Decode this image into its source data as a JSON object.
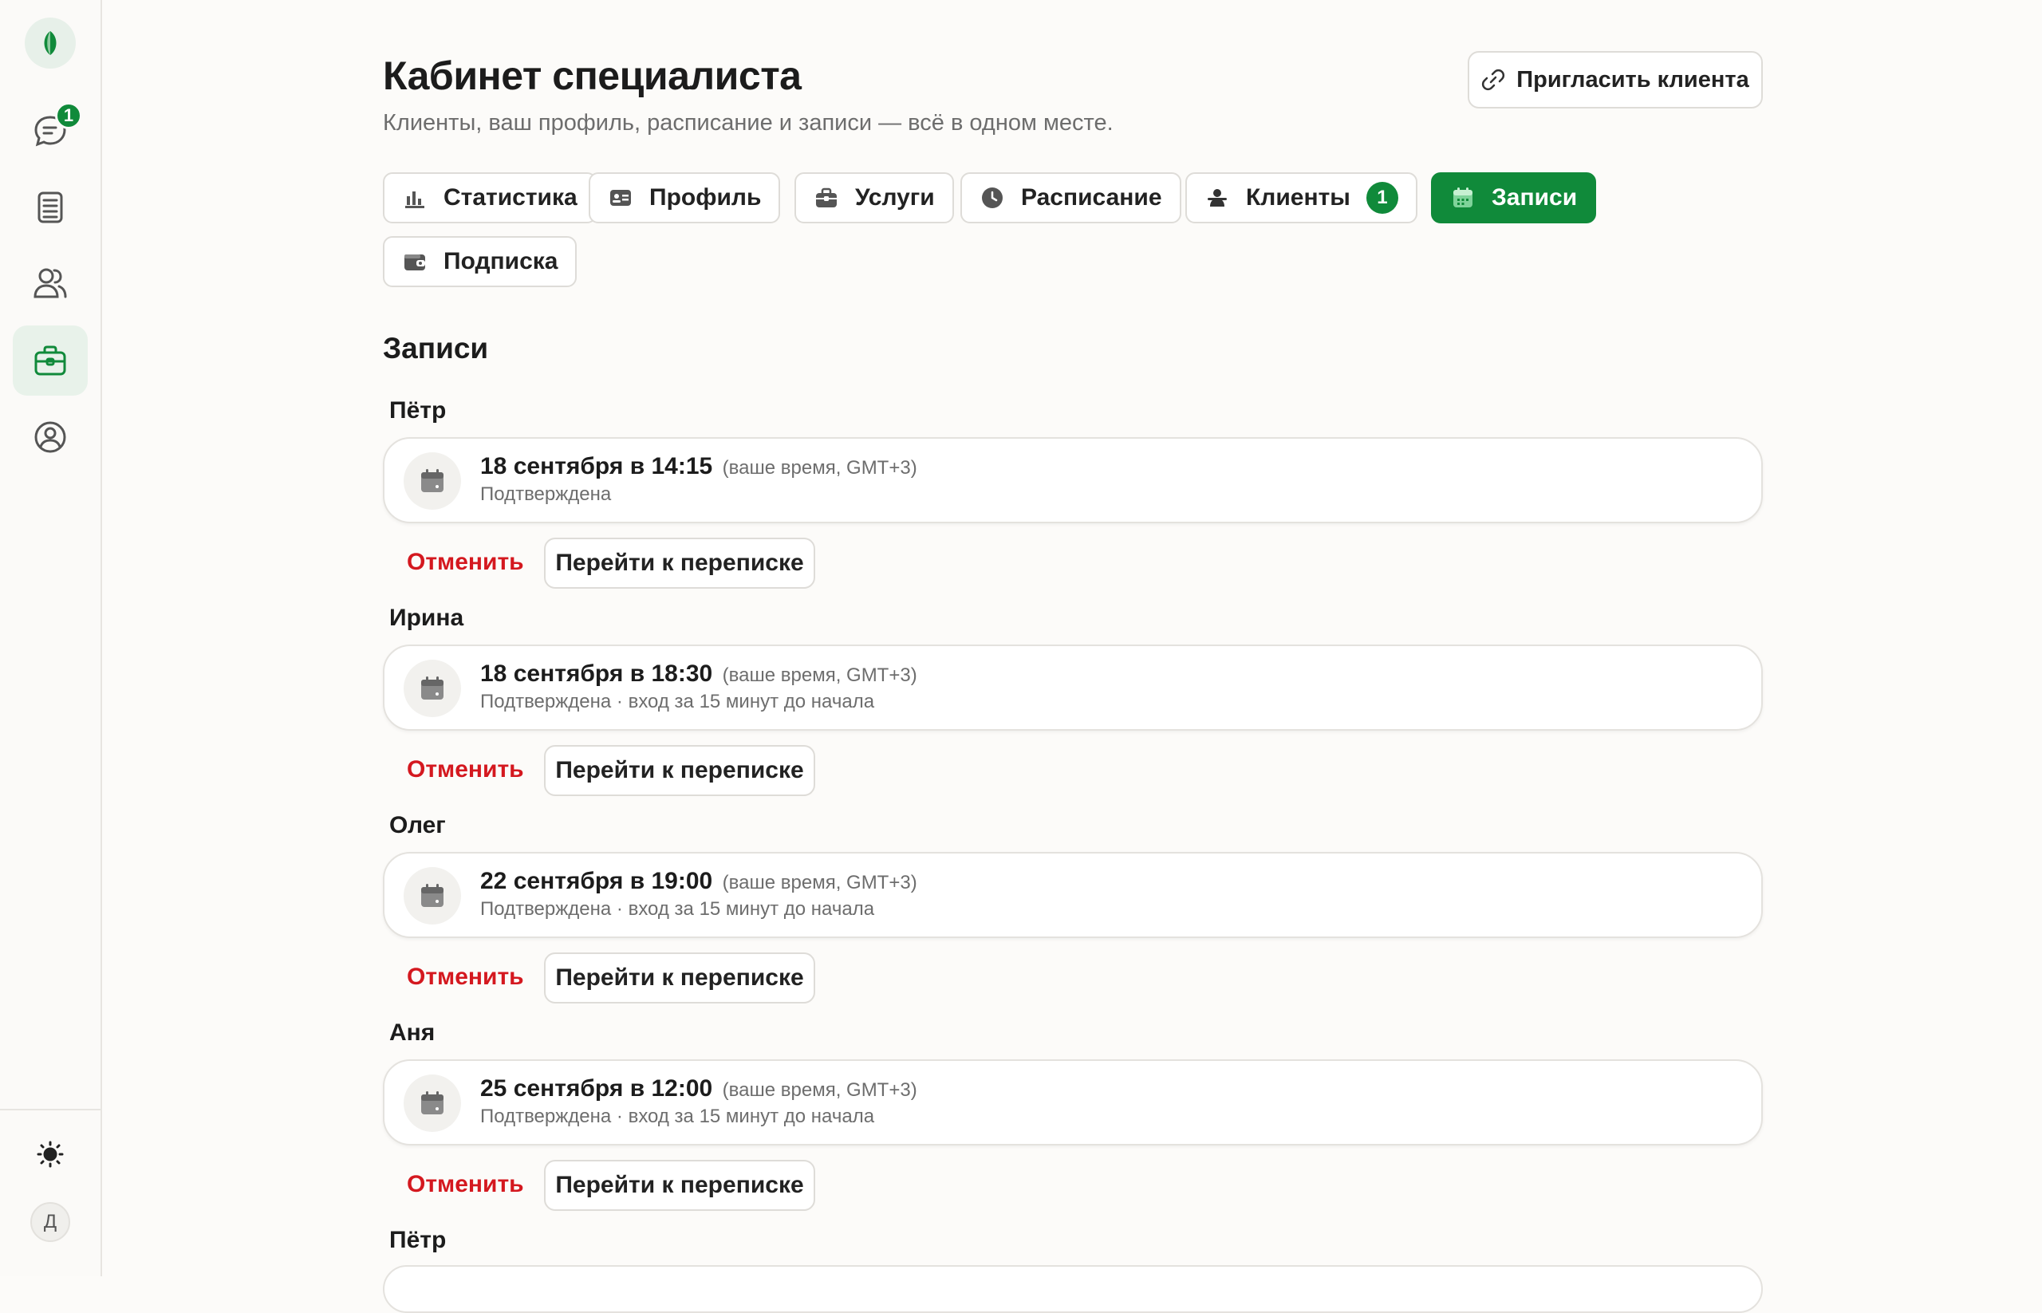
{
  "sidebar": {
    "notification_count": "1",
    "user_initial": "Д"
  },
  "header": {
    "title": "Кабинет специалиста",
    "subtitle": "Клиенты, ваш профиль, расписание и записи — всё в одном месте.",
    "invite_label": "Пригласить клиента"
  },
  "tabs": [
    {
      "label": "Статистика",
      "icon": "bar-chart-icon"
    },
    {
      "label": "Профиль",
      "icon": "id-card-icon"
    },
    {
      "label": "Услуги",
      "icon": "briefcase-icon"
    },
    {
      "label": "Расписание",
      "icon": "clock-icon"
    },
    {
      "label": "Клиенты",
      "icon": "people-icon",
      "count": "1"
    },
    {
      "label": "Записи",
      "icon": "calendar-icon",
      "active": true
    },
    {
      "label": "Подписка",
      "icon": "wallet-icon"
    }
  ],
  "section_title": "Записи",
  "bookings": [
    {
      "client": "Пётр",
      "date": "18 сентября в 14:15",
      "tz": "(ваше время, GMT+3)",
      "status": "Подтверждена"
    },
    {
      "client": "Ирина",
      "date": "18 сентября в 18:30",
      "tz": "(ваше время, GMT+3)",
      "status": "Подтверждена · вход за 15 минут до начала"
    },
    {
      "client": "Олег",
      "date": "22 сентября в 19:00",
      "tz": "(ваше время, GMT+3)",
      "status": "Подтверждена · вход за 15 минут до начала"
    },
    {
      "client": "Аня",
      "date": "25 сентября в 12:00",
      "tz": "(ваше время, GMT+3)",
      "status": "Подтверждена · вход за 15 минут до начала"
    },
    {
      "client": "Пётр"
    }
  ],
  "actions": {
    "cancel_label": "Отменить",
    "chat_label": "Перейти к переписке"
  },
  "colors": {
    "accent": "#108a3a",
    "danger": "#d4181f",
    "muted_text": "#6d6d6d"
  }
}
